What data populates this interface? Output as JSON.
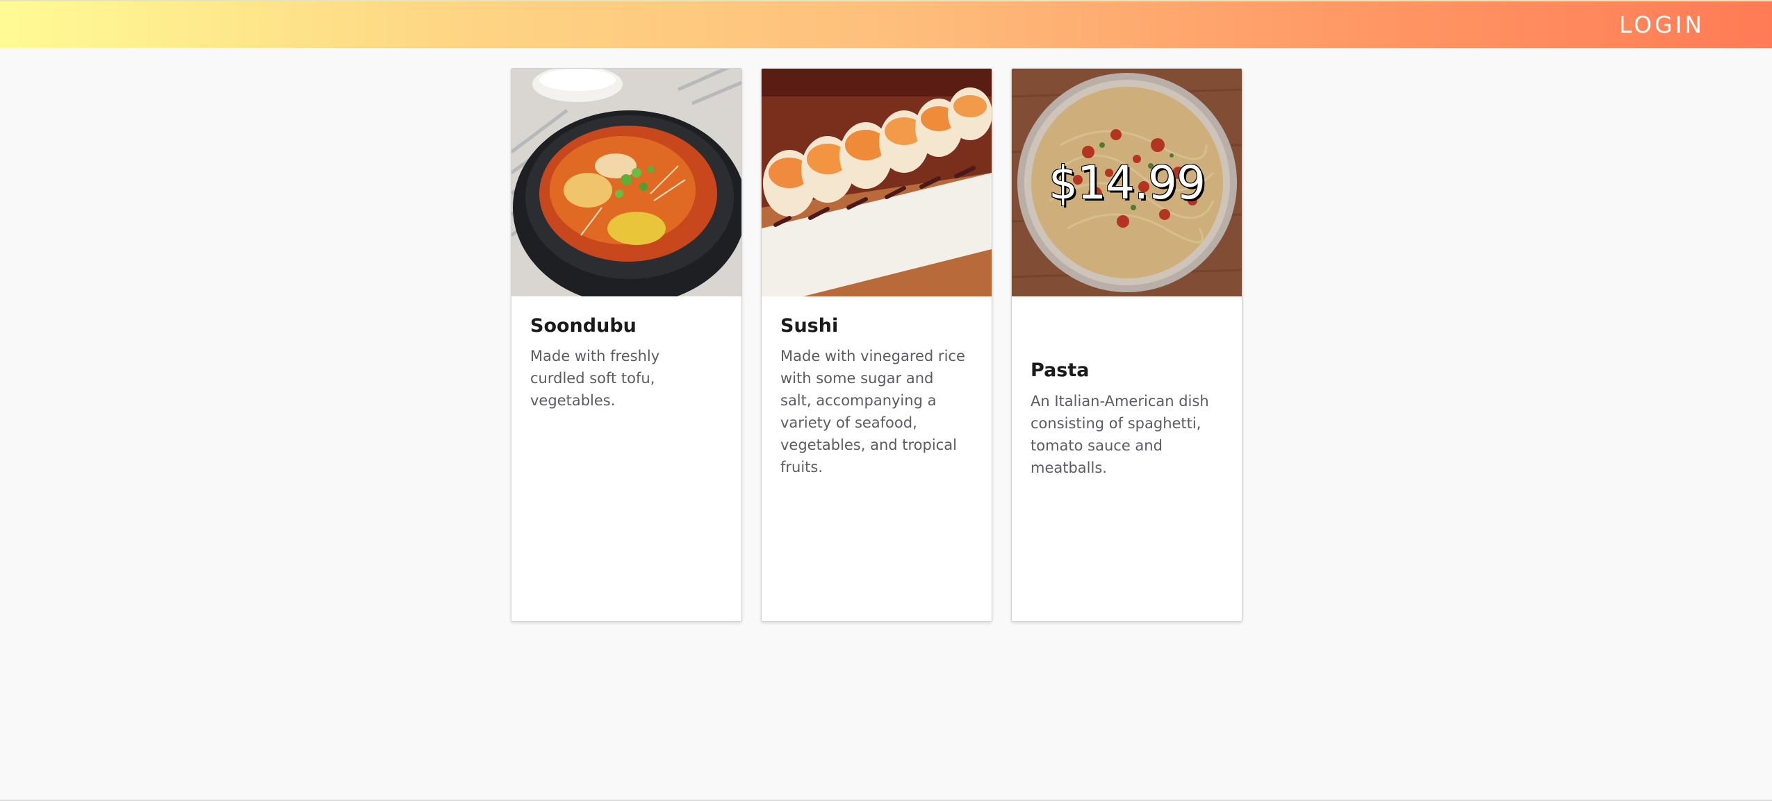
{
  "header": {
    "login_label": "LOGIN",
    "gradient_colors": [
      "#fffb94",
      "#febf7c",
      "#ff7b55"
    ]
  },
  "cards": [
    {
      "title": "Soondubu",
      "description": "Made with freshly curdled soft tofu, vegetables.",
      "image": "soondubu-photo"
    },
    {
      "title": "Sushi",
      "description": "Made with vinegared rice with some sugar and salt, accompanying a variety of seafood, vegetables, and tropical fruits.",
      "image": "sushi-photo"
    },
    {
      "title": "Pasta",
      "description": "An Italian-American dish consisting of spaghetti, tomato sauce and meatballs.",
      "price": "$14.99",
      "image": "pasta-photo"
    }
  ]
}
